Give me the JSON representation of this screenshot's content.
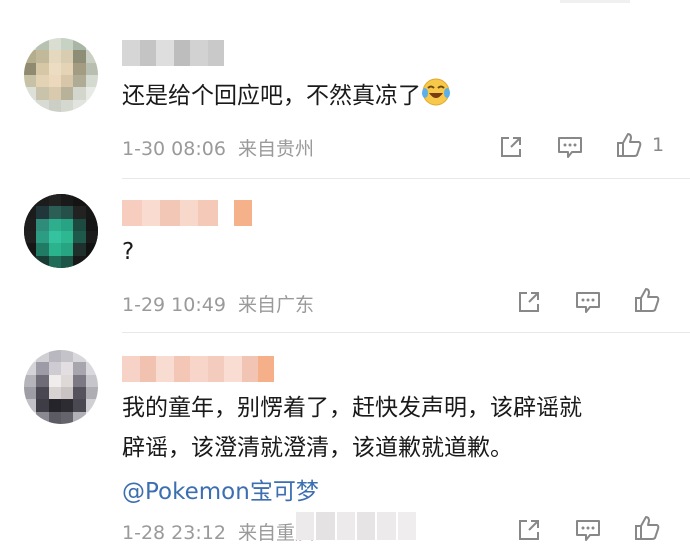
{
  "comments": [
    {
      "text": "还是给个回应吧，不然真凉了",
      "emoji": "laughing-crying-emoji",
      "date": "1-30 08:06",
      "source": "来自贵州",
      "like_count": "1"
    },
    {
      "text": "?",
      "date": "1-29 10:49",
      "source": "来自广东"
    },
    {
      "text_line1": "我的童年，别愣着了，赶快发声明，该辟谣就",
      "text_line2": "辟谣，该澄清就澄清，该道歉就道歉。",
      "mention": "@Pokemon宝可梦",
      "date": "1-28 23:12",
      "source": "来自重庆"
    }
  ],
  "colors": {
    "mention": "#3d6fb0",
    "meta": "#9a9a9a",
    "divider": "#e8e8e8"
  },
  "icons": [
    "share-icon",
    "comment-icon",
    "like-icon"
  ]
}
